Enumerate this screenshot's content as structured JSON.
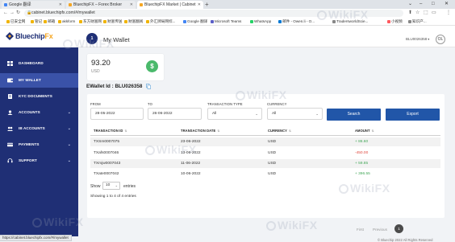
{
  "browser": {
    "tabs": [
      {
        "label": "Google 翻译",
        "color": "#4285f4"
      },
      {
        "label": "BluechipFX – Forex Broker",
        "color": "#f5a623"
      },
      {
        "label": "BluechipFX Market | Cabinet",
        "color": "#f5a623"
      }
    ],
    "new_tab_symbol": "+",
    "window_controls": [
      "⌄",
      "–",
      "□",
      "✕"
    ],
    "nav_buttons": [
      "←",
      "→",
      "↻"
    ],
    "url": "cabinet.bluechipfx.com/#/mywallet",
    "lock_symbol": "🔒",
    "toolbar_icons": [
      "⬆",
      "☆",
      "⬚",
      "▭",
      "⋮"
    ],
    "bookmarks": [
      "已安全网",
      "管记",
      "邮箱",
      "akkform",
      "东方财富网",
      "财富传送",
      "财富翻阅",
      "外汇牌局网综...",
      "Google 翻译",
      "Microsoft Teams",
      "WhatsApp",
      "邮件 - Owen.li - O...",
      "TradersworldScie...",
      "小视频",
      "知识产..."
    ],
    "status_url": "https://cabinet.bluechipfx.com/#/mywallet"
  },
  "app": {
    "brand_main": "Bluechip",
    "brand_fx": "Fx",
    "brand_color": "#1f2f75",
    "accent_color": "#f5a623",
    "nav": [
      {
        "label": "DASHBOARD",
        "icon": "dashboard-icon",
        "active": false,
        "chevron": ""
      },
      {
        "label": "MY WALLET",
        "icon": "wallet-icon",
        "active": true,
        "chevron": ""
      },
      {
        "label": "KYC DOCUMENTS",
        "icon": "document-icon",
        "active": false,
        "chevron": ""
      },
      {
        "label": "ACCOUNTS",
        "icon": "accounts-icon",
        "active": false,
        "chevron": "⌄"
      },
      {
        "label": "IB ACCOUNTS",
        "icon": "ib-accounts-icon",
        "active": false,
        "chevron": "⌄"
      },
      {
        "label": "PAYMENTS",
        "icon": "payments-icon",
        "active": false,
        "chevron": "⌄"
      },
      {
        "label": "SUPPORT",
        "icon": "support-icon",
        "active": false,
        "chevron": "⌄"
      }
    ],
    "header": {
      "step_number": "1",
      "title": "My Wallet",
      "user_id": "BLU0026358",
      "user_dropdown": "▾",
      "avatar_initials": "OL"
    },
    "balance": {
      "amount": "93.20",
      "currency": "USD",
      "badge_symbol": "$",
      "badge_color": "#4ab96b"
    },
    "ewallet_id": "EWallet Id : BLU026358",
    "filters": {
      "from_label": "FROM",
      "from_value": "28-05-2022",
      "to_label": "TO",
      "to_value": "26-06-2022",
      "type_label": "TRANSACTION TYPE",
      "type_value": "All",
      "currency_label": "CURRENCY",
      "currency_value": "All",
      "search_label": "Search",
      "export_label": "Export",
      "caret": "⌄",
      "button_color": "#2156a8"
    },
    "table": {
      "columns": [
        "TRANSACTION ID",
        "TRANSACTION DATE",
        "CURRENCY",
        "AMOUNT"
      ],
      "sort_symbol": "⇅",
      "rows": [
        {
          "id": "TXSm0007075",
          "date": "23-06-2022",
          "currency": "USD",
          "amount": "+ 86.60",
          "sign": "pos"
        },
        {
          "id": "TXafs0007046",
          "date": "13-06-2022",
          "currency": "USD",
          "amount": "-450.00",
          "sign": "neg"
        },
        {
          "id": "TXmjw0007043",
          "date": "11-06-2022",
          "currency": "USD",
          "amount": "+ 59.85",
          "sign": "pos"
        },
        {
          "id": "TXate0007042",
          "date": "10-06-2022",
          "currency": "USD",
          "amount": "+ 396.55",
          "sign": "pos"
        }
      ],
      "positive_color": "#45a85a",
      "negative_color": "#e04a3f"
    },
    "pagination": {
      "show_label": "Show",
      "show_value": "10",
      "entries_label": "entries",
      "info": "Showing 1 to 4 of 4 entries",
      "first": "First",
      "previous": "Previous",
      "current_page": "1"
    },
    "footer": "© Bluechip 2022 All Rights Reserved"
  },
  "watermark": "WikiFX"
}
